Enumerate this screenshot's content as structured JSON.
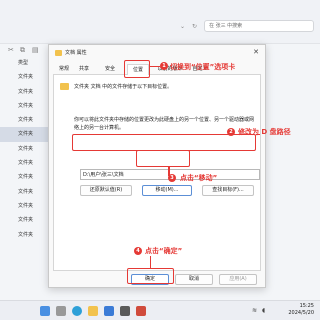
{
  "explorer": {
    "search_placeholder": "在 张三 中搜索",
    "sidebar_items": [
      "类型",
      "文件夹",
      "文件夹",
      "文件夹",
      "文件夹",
      "文件夹",
      "文件夹",
      "文件夹",
      "文件夹",
      "文件夹",
      "文件夹",
      "文件夹",
      "文件夹"
    ],
    "selected_index": 5
  },
  "dialog": {
    "title": "文档 属性",
    "tabs": [
      "常规",
      "共享",
      "位置",
      "安全",
      "以前的版本",
      "自定义"
    ],
    "active_tab": "位置",
    "intro": "文件夹 文档 中的文件存储于以下目标位置。",
    "description": "你可以将此文件夹中存储的位置更改为此硬盘上的另一个位置、另一个驱动器或网络上的另一台计算机。",
    "path_value": "D:\\用户\\张三\\文档",
    "buttons": {
      "restore": "还原默认值(R)",
      "move": "移动(M)...",
      "find_target": "查找目标(F)..."
    },
    "footer": {
      "ok": "确定",
      "cancel": "取消",
      "apply": "应用(A)"
    }
  },
  "annotations": {
    "step1": {
      "num": "1",
      "text": "切换到“位置”选项卡"
    },
    "step2": {
      "num": "2",
      "text": "修改为 D 盘路径"
    },
    "step3": {
      "num": "3",
      "text": "点击“移动”"
    },
    "step4": {
      "num": "4",
      "text": "点击“确定”"
    }
  },
  "taskbar": {
    "time": "15:25",
    "date": "2024/5/20"
  },
  "colors": {
    "accent_red": "#e53935",
    "folder_yellow": "#f2c24d"
  }
}
